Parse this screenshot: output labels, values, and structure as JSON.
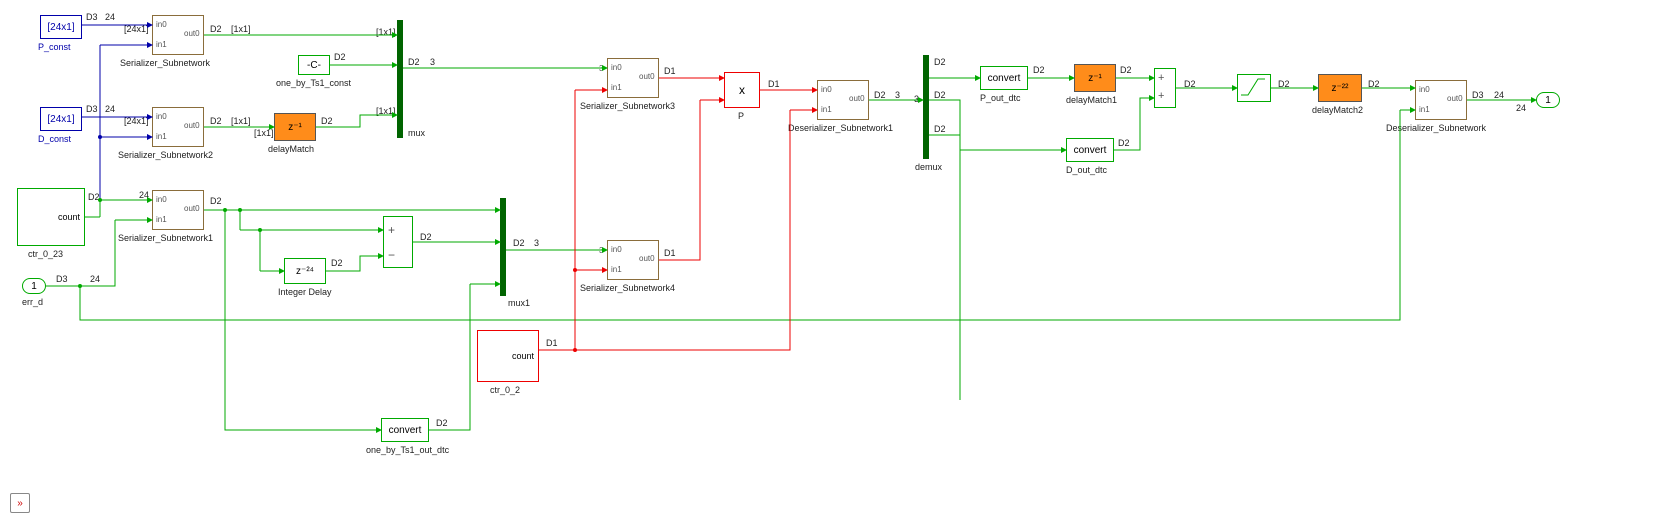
{
  "inputs": {
    "p_const_txt": "[24x1]",
    "p_const_name": "P_const",
    "d_const_txt": "[24x1]",
    "d_const_name": "D_const",
    "one_by_ts1_txt": "-C-",
    "one_by_ts1_name": "one_by_Ts1_const",
    "ctr023_txt": "count",
    "ctr023_name": "ctr_0_23",
    "err_d_txt": "1",
    "err_d_name": "err_d",
    "ctr02_txt": "count",
    "ctr02_name": "ctr_0_2"
  },
  "serial": {
    "sn": "Serializer_Subnetwork",
    "sn1": "Serializer_Subnetwork1",
    "sn2": "Serializer_Subnetwork2",
    "sn3": "Serializer_Subnetwork3",
    "sn4": "Serializer_Subnetwork4",
    "dsn": "Deserializer_Subnetwork",
    "dsn1": "Deserializer_Subnetwork1",
    "p_in0": "in0",
    "p_in1": "in1",
    "p_out0": "out0"
  },
  "delay": {
    "dm": "delayMatch",
    "dm_txt": "z⁻¹",
    "dm1": "delayMatch1",
    "dm1_txt": "z⁻¹",
    "dm2": "delayMatch2",
    "dm2_txt": "z⁻²²",
    "intdel": "Integer Delay",
    "intdel_txt": "z⁻²⁴"
  },
  "conv": {
    "p": "P_out_dtc",
    "d": "D_out_dtc",
    "obt": "one_by_Ts1_out_dtc",
    "txt": "convert"
  },
  "mux": {
    "m": "mux",
    "m1": "mux1",
    "dm": "demux"
  },
  "mult": {
    "name": "P",
    "txt": "x"
  },
  "outport": {
    "txt": "1"
  },
  "sig": {
    "d1": "D1",
    "d2": "D2",
    "d3": "D3",
    "s24": "24",
    "s3": "3",
    "v24x1": "[24x1]",
    "v1x1": "[1x1]"
  }
}
